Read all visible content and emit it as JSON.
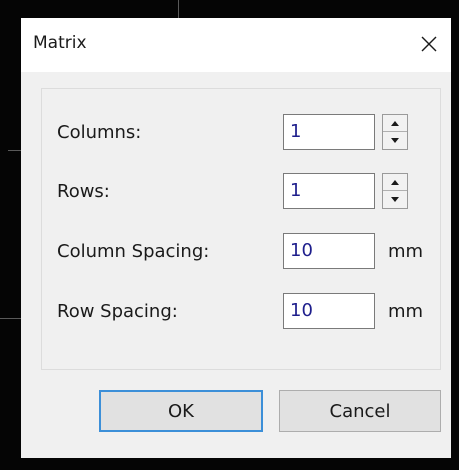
{
  "dialog": {
    "title": "Matrix",
    "close_icon": "close-icon"
  },
  "fields": {
    "columns": {
      "label": "Columns:",
      "value": "1"
    },
    "rows": {
      "label": "Rows:",
      "value": "1"
    },
    "column_spacing": {
      "label": "Column Spacing:",
      "value": "10",
      "unit": "mm"
    },
    "row_spacing": {
      "label": "Row Spacing:",
      "value": "10",
      "unit": "mm"
    }
  },
  "icons": {
    "spin_up": "spin-up-arrow-icon",
    "spin_down": "spin-down-arrow-icon"
  },
  "buttons": {
    "ok": "OK",
    "cancel": "Cancel"
  },
  "colors": {
    "focus_border": "#3c8fd8",
    "input_text": "#1e1e8c"
  }
}
